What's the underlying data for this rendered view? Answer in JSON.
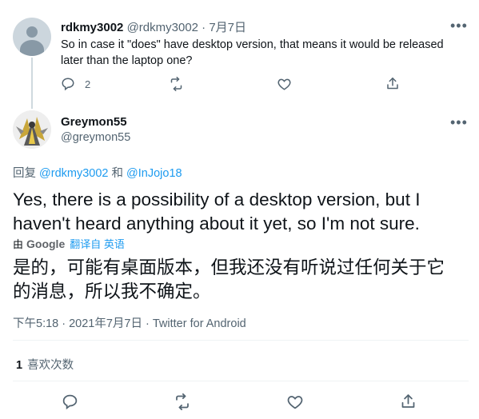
{
  "parent_tweet": {
    "display_name": "rdkmy3002",
    "handle_and_date": "@rdkmy3002 · 7月7日",
    "text_line1": "So in case it \"does\" have desktop version, that means it would be released",
    "text_line2": "later than the laptop one?",
    "reply_count": "2"
  },
  "main_tweet": {
    "display_name": "Greymon55",
    "handle": "@greymon55",
    "reply_prefix": "回复",
    "reply_to_1": "@rdkmy3002",
    "reply_and": "和",
    "reply_to_2": "@InJojo18",
    "text_line1": "Yes, there is a possibility of a desktop version, but I",
    "text_line2": "haven't heard anything about it yet, so I'm not sure.",
    "translate_by": "由",
    "translate_brand": "Google",
    "translate_from": "翻译自 英语",
    "translated_line1": "是的，可能有桌面版本，但我还没有听说过任何关于它",
    "translated_line2": "的消息，所以我不确定。",
    "timestamp": "下午5:18 · 2021年7月7日 · Twitter for Android",
    "likes_count": "1",
    "likes_label": "喜欢次数"
  },
  "colors": {
    "link": "#1d9bf0",
    "muted": "#536471",
    "text": "#0f1419"
  },
  "icons": {
    "reply": "reply-icon",
    "retweet": "retweet-icon",
    "like": "heart-icon",
    "share": "share-icon",
    "more": "more-icon"
  }
}
